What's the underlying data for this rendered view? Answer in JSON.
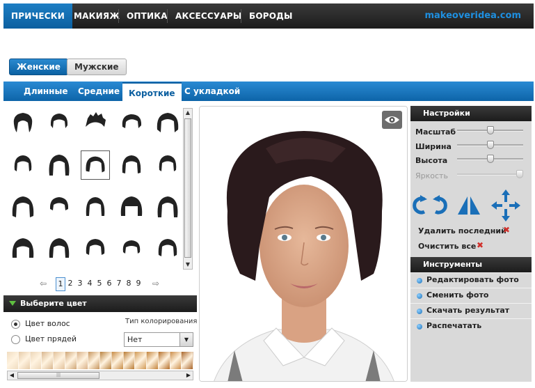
{
  "nav": {
    "tabs": [
      "ПРИЧЕСКИ",
      "МАКИЯЖ",
      "ОПТИКА",
      "АКСЕССУАРЫ",
      "БОРОДЫ"
    ],
    "active_tab": 0,
    "logo": "makeoveridea.com"
  },
  "gender": {
    "female": "Женские",
    "male": "Мужские",
    "active": "female"
  },
  "subtabs": {
    "items": [
      "Длинные",
      "Средние",
      "Короткие",
      "С укладкой"
    ],
    "active": 2
  },
  "gallery": {
    "selected_index": 7
  },
  "pager": {
    "pages": [
      "1",
      "2",
      "3",
      "4",
      "5",
      "6",
      "7",
      "8",
      "9"
    ],
    "current": "1",
    "prev_icon": "arrow-left-icon",
    "next_icon": "arrow-right-icon"
  },
  "color": {
    "title": "Выберите цвет",
    "hair_color": "Цвет волос",
    "strands_color": "Цвет прядей",
    "selected_mode": "hair_color",
    "coloring_type_label": "Тип колорирования",
    "coloring_type_value": "Нет",
    "swatches": [
      "#f0dcc0",
      "#e6cba8",
      "#ecd6b8",
      "#d8b68e",
      "#e2c19a",
      "#cfa676",
      "#d9b087",
      "#c6955e",
      "#b9823f",
      "#c88c45",
      "#b97b33",
      "#d29a55",
      "#c4843c",
      "#b56f2a",
      "#cc8e4a",
      "#a9652a"
    ]
  },
  "settings": {
    "title": "Настройки",
    "sliders": [
      {
        "label": "Масштаб",
        "value": 0.5,
        "enabled": true
      },
      {
        "label": "Ширина",
        "value": 0.5,
        "enabled": true
      },
      {
        "label": "Высота",
        "value": 0.5,
        "enabled": true
      },
      {
        "label": "Яркость",
        "value": 1.0,
        "enabled": false
      }
    ],
    "delete_last": "Удалить последний",
    "clear_all": "Очистить все"
  },
  "tools": {
    "title": "Инструменты",
    "items": [
      "Редактировать фото",
      "Сменить фото",
      "Скачать результат",
      "Распечатать"
    ]
  },
  "icons": {
    "eye": "eye-icon",
    "rotate": "rotate-icon",
    "flip": "flip-icon",
    "move": "move-arrows-icon",
    "delete": "close-icon"
  },
  "colors": {
    "brand_blue": "#0b5fa0",
    "dark_bar": "#222222",
    "panel_gray": "#d9d9d9",
    "hair_dark": "#2a1a1c",
    "logo_blue": "#1e8fe0"
  }
}
